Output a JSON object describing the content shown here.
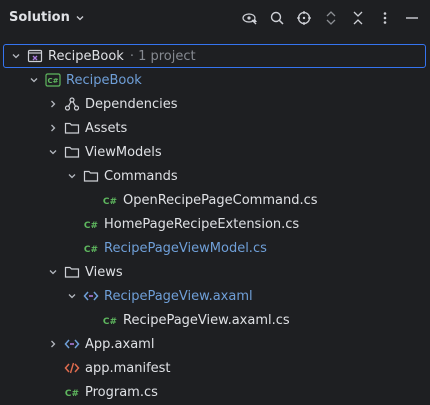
{
  "header": {
    "title": "Solution",
    "toolbar": [
      {
        "name": "locate-icon"
      },
      {
        "name": "search-icon"
      },
      {
        "name": "target-icon"
      },
      {
        "name": "expand-icon"
      },
      {
        "name": "collapse-icon"
      },
      {
        "name": "more-icon"
      },
      {
        "name": "minimize-icon"
      }
    ]
  },
  "tree": [
    {
      "label": "RecipeBook",
      "suffix": "· 1 project",
      "icon": "solution",
      "arrow": "down",
      "depth": 0,
      "style": "normal",
      "selected": true
    },
    {
      "label": "RecipeBook",
      "icon": "csproj",
      "arrow": "down",
      "depth": 1,
      "style": "blue"
    },
    {
      "label": "Dependencies",
      "icon": "deps",
      "arrow": "right",
      "depth": 2,
      "style": "normal"
    },
    {
      "label": "Assets",
      "icon": "folder",
      "arrow": "right",
      "depth": 2,
      "style": "normal"
    },
    {
      "label": "ViewModels",
      "icon": "folder",
      "arrow": "down",
      "depth": 2,
      "style": "normal"
    },
    {
      "label": "Commands",
      "icon": "folder",
      "arrow": "down",
      "depth": 3,
      "style": "normal"
    },
    {
      "label": "OpenRecipePageCommand.cs",
      "icon": "cs",
      "arrow": "none",
      "depth": 4,
      "style": "normal"
    },
    {
      "label": "HomePageRecipeExtension.cs",
      "icon": "cs",
      "arrow": "none",
      "depth": 3,
      "style": "normal"
    },
    {
      "label": "RecipePageViewModel.cs",
      "icon": "cs",
      "arrow": "none",
      "depth": 3,
      "style": "blue"
    },
    {
      "label": "Views",
      "icon": "folder",
      "arrow": "down",
      "depth": 2,
      "style": "normal"
    },
    {
      "label": "RecipePageView.axaml",
      "icon": "axaml",
      "arrow": "down",
      "depth": 3,
      "style": "blue"
    },
    {
      "label": "RecipePageView.axaml.cs",
      "icon": "cs",
      "arrow": "none",
      "depth": 4,
      "style": "normal"
    },
    {
      "label": "App.axaml",
      "icon": "axaml",
      "arrow": "right",
      "depth": 2,
      "style": "normal"
    },
    {
      "label": "app.manifest",
      "icon": "manifest",
      "arrow": "none",
      "depth": 2,
      "style": "normal"
    },
    {
      "label": "Program.cs",
      "icon": "cs",
      "arrow": "none",
      "depth": 2,
      "style": "normal"
    }
  ],
  "colors": {
    "background": "#1e1f22",
    "selection_border": "#3574f0",
    "blue_text": "#6f9fd8",
    "cs_green": "#5fb85f"
  }
}
